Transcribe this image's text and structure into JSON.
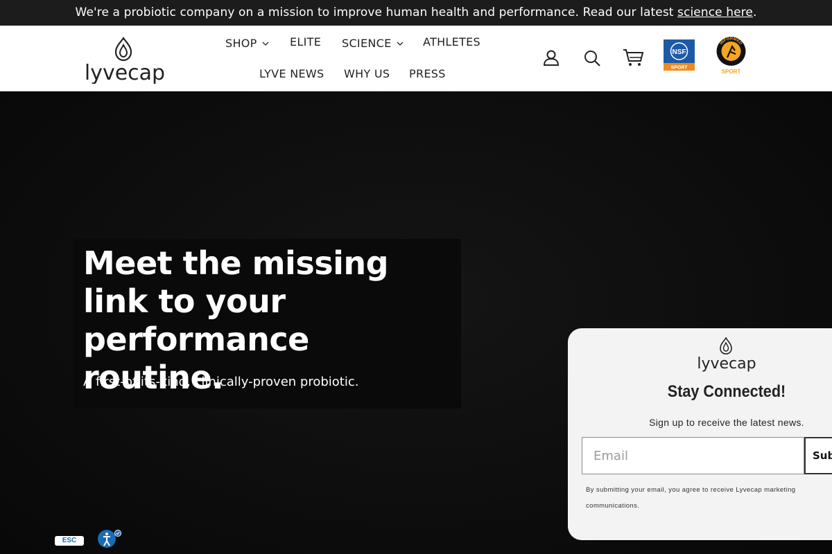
{
  "announcement": {
    "text": "We're a probiotic company on a mission to improve human health and performance. Read our latest ",
    "link": "science here",
    "end": "."
  },
  "header": {
    "logo_text": "lyvecap",
    "nav": {
      "shop": "SHOP",
      "elite": "ELITE",
      "science": "SCIENCE",
      "athletes": "ATHLETES",
      "lyve_news": "LYVE NEWS",
      "why_us": "WHY US",
      "press": "PRESS"
    },
    "icons": [
      "account-icon",
      "search-icon",
      "cart-icon"
    ],
    "badges": {
      "nsf": {
        "top": "NSF",
        "bottom": "SPORT"
      },
      "informed": {
        "ring": "INFORMED",
        "bottom": "SPORT"
      }
    }
  },
  "hero": {
    "title": "Meet the missing link to your performance routine.",
    "subtitle": "A first-of-its-kind, clinically-proven probiotic."
  },
  "popup": {
    "logo_text": "lyvecap",
    "title": "Stay Connected!",
    "subtitle": "Sign up to receive the latest news.",
    "email_placeholder": "Email",
    "submit_label": "Sub",
    "disclaimer": "By submitting your email, you agree to receive Lyvecap marketing communications."
  },
  "accessibility": {
    "esc_label": "ESC"
  },
  "colors": {
    "nsf_blue": "#1d5aa6",
    "nsf_orange": "#f08a1c",
    "informed_orange": "#f5a623"
  }
}
